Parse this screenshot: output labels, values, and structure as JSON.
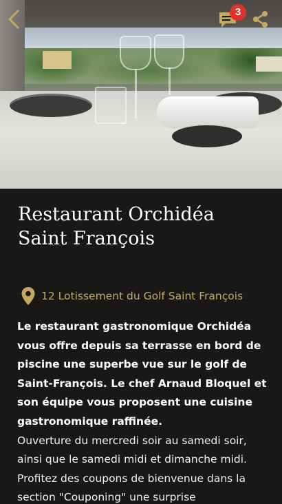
{
  "header": {
    "back_icon": "chevron-left-icon",
    "chat_icon": "chat-bubble-icon",
    "chat_badge_count": "3",
    "share_icon": "share-icon",
    "icon_color": "#c3a95f",
    "badge_color": "#e0312d"
  },
  "hero": {
    "image_alt": "Terrasse du restaurant avec vue sur le golf"
  },
  "restaurant": {
    "name": "Restaurant Orchidéa Saint François",
    "address_icon": "map-pin-icon",
    "address": "12 Lotissement du Golf Saint François",
    "description_lead": "Le restaurant gastronomique Orchidéa vous offre depuis sa terrasse en bord de piscine une superbe vue sur le golf de Saint-François. Le chef Arnaud Bloquel et son équipe vous proposent une cuisine gastronomique raffinée.",
    "description_rest": "Ouverture du mercredi soir au samedi soir, ainsi que le samedi midi et dimanche midi. Profitez des coupons de bienvenue dans  la section \"Couponing\" une surprise"
  },
  "theme": {
    "background": "#1a1817",
    "accent": "#c3a95f",
    "text": "#ffffff"
  }
}
